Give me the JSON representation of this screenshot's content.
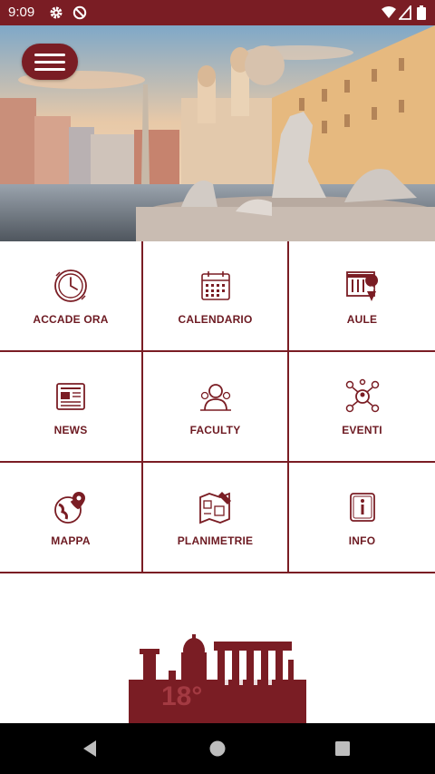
{
  "status_bar": {
    "time": "9:09",
    "icons": [
      "settings-icon",
      "do-not-disturb-icon",
      "wifi-icon",
      "signal-icon",
      "battery-icon"
    ]
  },
  "header": {
    "menu_icon": "hamburger-menu-icon"
  },
  "grid": {
    "items": [
      {
        "label": "ACCADE ORA",
        "icon": "clock-icon"
      },
      {
        "label": "CALENDARIO",
        "icon": "calendar-icon"
      },
      {
        "label": "AULE",
        "icon": "room-location-icon"
      },
      {
        "label": "NEWS",
        "icon": "newspaper-icon"
      },
      {
        "label": "FACULTY",
        "icon": "faculty-people-icon"
      },
      {
        "label": "EVENTI",
        "icon": "network-people-icon"
      },
      {
        "label": "MAPPA",
        "icon": "globe-pin-icon"
      },
      {
        "label": "PLANIMETRIE",
        "icon": "floor-plan-icon"
      },
      {
        "label": "INFO",
        "icon": "info-icon"
      }
    ]
  },
  "logo": {
    "text": "18°"
  },
  "nav_bar": {
    "icons": [
      "back-icon",
      "home-icon",
      "recents-icon"
    ]
  },
  "colors": {
    "brand": "#7a1d24",
    "label": "#6d1a22",
    "status_bar": "#7a1d24",
    "nav_bar": "#000000"
  }
}
